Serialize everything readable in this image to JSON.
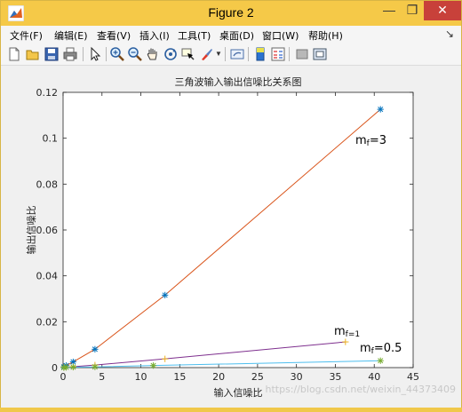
{
  "window": {
    "title": "Figure 2",
    "min_label": "—",
    "max_label": "❐",
    "close_label": "✕"
  },
  "menu": {
    "items": [
      "文件(F)",
      "编辑(E)",
      "查看(V)",
      "插入(I)",
      "工具(T)",
      "桌面(D)",
      "窗口(W)",
      "帮助(H)"
    ],
    "overflow": "↘"
  },
  "toolbar": {
    "icons": [
      "new-file-icon",
      "open-folder-icon",
      "save-icon",
      "print-icon",
      "pointer-icon",
      "zoom-in-icon",
      "zoom-out-icon",
      "pan-hand-icon",
      "rotate-3d-icon",
      "data-cursor-icon",
      "brush-icon",
      "brush-dropdown-icon",
      "link-plot-icon",
      "colorbar-icon",
      "legend-icon",
      "hide-plot-tools-icon",
      "show-plot-tools-icon"
    ]
  },
  "chart_data": {
    "type": "line",
    "title": "三角波输入输出信噪比关系图",
    "xlabel": "输入信噪比",
    "ylabel": "输出信噪比",
    "xlim": [
      0,
      45
    ],
    "ylim": [
      0,
      0.12
    ],
    "xticks": [
      0,
      5,
      10,
      15,
      20,
      25,
      30,
      35,
      40,
      45
    ],
    "yticks": [
      0,
      0.02,
      0.04,
      0.06,
      0.08,
      0.1,
      0.12
    ],
    "ytick_labels": [
      "0",
      "0.02",
      "0.04",
      "0.06",
      "0.08",
      "0.1",
      "0.12"
    ],
    "grid": false,
    "series": [
      {
        "name": "mf=3",
        "color": "#d95319",
        "marker": "*",
        "marker_color": "#0072bd",
        "x": [
          0.1,
          0.4,
          1.3,
          4.1,
          13.1,
          40.8
        ],
        "y": [
          0.0003,
          0.0009,
          0.0025,
          0.008,
          0.0316,
          0.1126
        ]
      },
      {
        "name": "mf=1",
        "color": "#7e2f8e",
        "marker": "+",
        "marker_color": "#edb120",
        "x": [
          0.1,
          0.4,
          1.3,
          4.1,
          13.1,
          36.3
        ],
        "y": [
          0.0001,
          0.0002,
          0.0004,
          0.0011,
          0.0038,
          0.0112
        ]
      },
      {
        "name": "mf=0.5",
        "color": "#4dbeee",
        "marker": "*",
        "marker_color": "#77ac30",
        "x": [
          0.1,
          0.4,
          1.3,
          4.1,
          11.6,
          40.8
        ],
        "y": [
          0.0,
          0.0001,
          0.0002,
          0.0003,
          0.0009,
          0.003
        ]
      }
    ],
    "annotations": [
      {
        "base": "m",
        "sub": "f",
        "rest": "=3",
        "series": "mf=3"
      },
      {
        "base": "m",
        "sub": "f=1",
        "rest": "",
        "series": "mf=1"
      },
      {
        "base": "m",
        "sub": "f",
        "rest": "=0.5",
        "series": "mf=0.5"
      }
    ]
  },
  "watermark": "https://blog.csdn.net/weixin_44373409"
}
